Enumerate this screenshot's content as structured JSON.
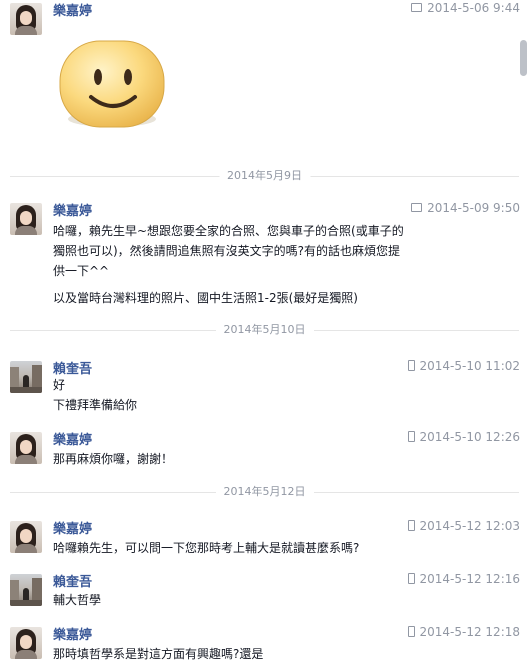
{
  "thread": {
    "messages": [
      {
        "sender": "樂嘉婷",
        "avatar": "female-avatar",
        "time": "2014-5-06 9:44",
        "source_icon": "chat-icon",
        "lines": [],
        "sticker": "smiley-face-sticker"
      },
      {
        "divider": "2014年5月9日"
      },
      {
        "sender": "樂嘉婷",
        "avatar": "female-avatar",
        "time": "2014-5-09 9:50",
        "source_icon": "chat-icon",
        "lines": [
          "哈囉，賴先生早~想跟您要全家的合照、您與車子的合照(或車子的",
          "獨照也可以)，然後請問追焦照有沒英文字的嗎?有的話也麻煩您提",
          "供一下^^",
          "以及當時台灣料理的照片、國中生活照1-2張(最好是獨照)"
        ]
      },
      {
        "divider": "2014年5月10日"
      },
      {
        "sender": "賴奎吾",
        "avatar": "male-avatar",
        "time": "2014-5-10 11:02",
        "source_icon": "phone-icon",
        "lines": [
          "好",
          "下禮拜準備給你"
        ]
      },
      {
        "sender": "樂嘉婷",
        "avatar": "female-avatar",
        "time": "2014-5-10 12:26",
        "source_icon": "phone-icon",
        "lines": [
          "那再麻煩你囉，謝謝！"
        ]
      },
      {
        "divider": "2014年5月12日"
      },
      {
        "sender": "樂嘉婷",
        "avatar": "female-avatar",
        "time": "2014-5-12 12:03",
        "source_icon": "phone-icon",
        "lines": [
          "哈囉賴先生，可以問一下您那時考上輔大是就讀甚麼系嗎?"
        ]
      },
      {
        "sender": "賴奎吾",
        "avatar": "male-avatar",
        "time": "2014-5-12 12:16",
        "source_icon": "phone-icon",
        "lines": [
          "輔大哲學"
        ]
      },
      {
        "sender": "樂嘉婷",
        "avatar": "female-avatar",
        "time": "2014-5-12 12:18",
        "source_icon": "phone-icon",
        "lines": [
          "那時填哲學系是對這方面有興趣嗎?還是"
        ]
      }
    ]
  },
  "colors": {
    "sender": "#3b5998",
    "meta": "#9197a3",
    "text": "#141823",
    "sticker": "#fbd97e"
  }
}
